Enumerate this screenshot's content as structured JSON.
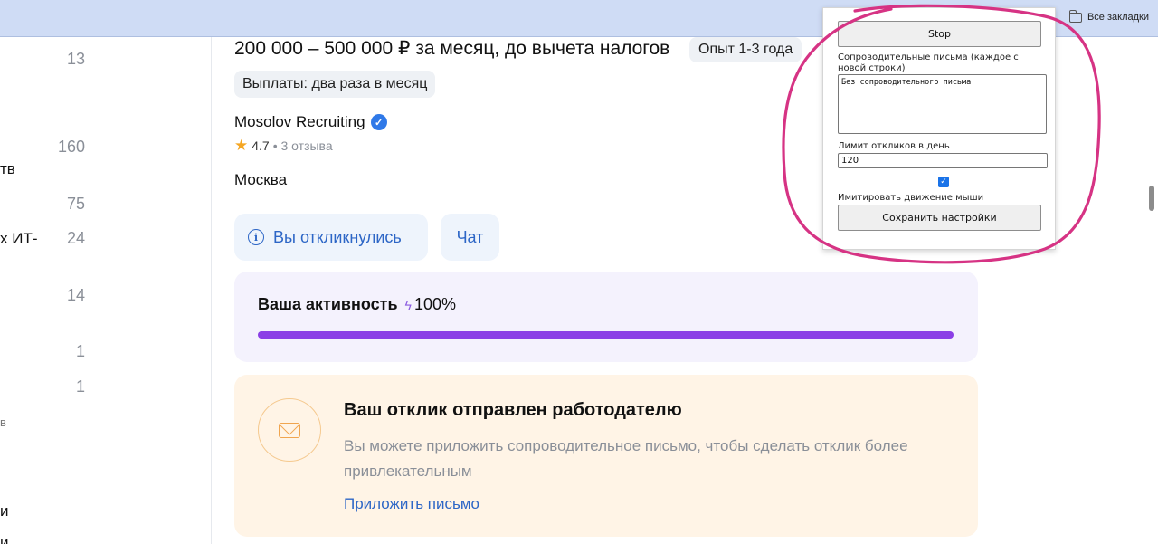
{
  "bookmarks": {
    "all_bookmarks": "Все закладки"
  },
  "left_filters": {
    "counts": [
      "13",
      "160",
      "75",
      "24",
      "14",
      "1",
      "1"
    ],
    "fragments": [
      "тв",
      "х ИТ-",
      "в",
      "и",
      "и"
    ]
  },
  "vacancy": {
    "salary": "200 000 – 500 000 ₽ за месяц, до вычета налогов",
    "experience": "Опыт 1-3 года",
    "payments": "Выплаты: два раза в месяц",
    "company": "Mosolov Recruiting",
    "rating": "4.7",
    "reviews": "• 3 отзыва",
    "city": "Москва",
    "responded_label": "Вы откликнулись",
    "chat_label": "Чат"
  },
  "activity": {
    "label": "Ваша активность",
    "percent_text": "100%",
    "progress": 1.0
  },
  "response_sent": {
    "title": "Ваш отклик отправлен работодателю",
    "description": "Вы можете приложить сопроводительное письмо, чтобы сделать отклик более привлекательным",
    "link": "Приложить письмо"
  },
  "extension_popup": {
    "stop_label": "Stop",
    "cover_letters_label": "Сопроводительные письма (каждое с новой строки)",
    "cover_letters_value": "Без сопроводительного письма",
    "daily_limit_label": "Лимит откликов в день",
    "daily_limit_value": "120",
    "mouse_checkbox_checked": true,
    "mouse_label": "Имитировать движение мыши",
    "save_label": "Сохранить настройки"
  },
  "colors": {
    "accent_blue": "#2d66c6",
    "progress_purple": "#8b3fe6",
    "annotation_pink": "#d63384",
    "sent_bg": "#fff4e6"
  }
}
